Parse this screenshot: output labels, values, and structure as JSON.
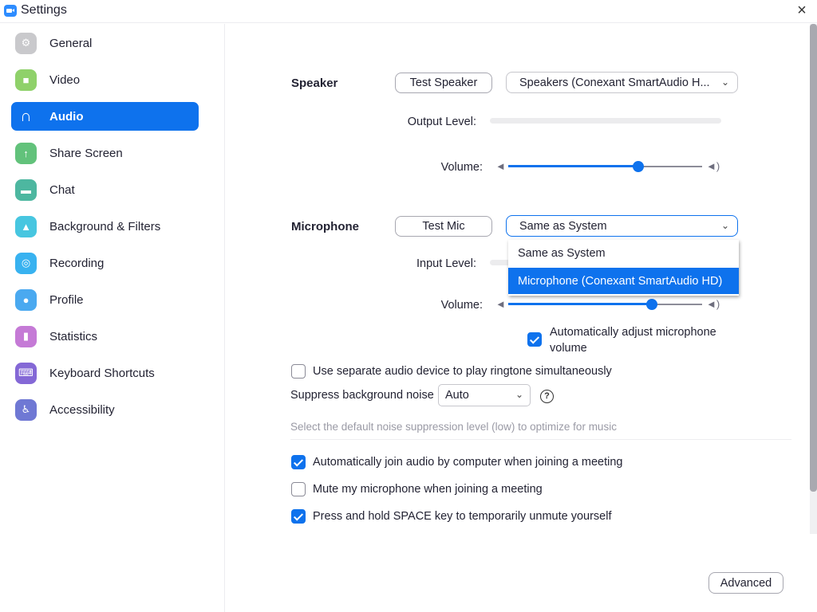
{
  "window": {
    "title": "Settings",
    "close_icon": "×"
  },
  "sidebar": {
    "items": [
      {
        "label": "General",
        "icon": "gear-icon",
        "color": "#c9c9cc",
        "glyph": "⚙",
        "active": false
      },
      {
        "label": "Video",
        "icon": "video-camera-icon",
        "color": "#8fd16a",
        "glyph": "■",
        "active": false
      },
      {
        "label": "Audio",
        "icon": "headphones-icon",
        "color": "#0e72ed",
        "glyph": "∩",
        "active": true
      },
      {
        "label": "Share Screen",
        "icon": "share-screen-icon",
        "color": "#62c27b",
        "glyph": "↑",
        "active": false
      },
      {
        "label": "Chat",
        "icon": "chat-icon",
        "color": "#4db7a0",
        "glyph": "▬",
        "active": false
      },
      {
        "label": "Background & Filters",
        "icon": "background-icon",
        "color": "#47c6e0",
        "glyph": "▲",
        "active": false
      },
      {
        "label": "Recording",
        "icon": "recording-icon",
        "color": "#38b2f0",
        "glyph": "◎",
        "active": false
      },
      {
        "label": "Profile",
        "icon": "profile-icon",
        "color": "#4aa9f0",
        "glyph": "●",
        "active": false
      },
      {
        "label": "Statistics",
        "icon": "statistics-icon",
        "color": "#c57ad6",
        "glyph": "▮",
        "active": false
      },
      {
        "label": "Keyboard Shortcuts",
        "icon": "keyboard-icon",
        "color": "#8468d6",
        "glyph": "⌨",
        "active": false
      },
      {
        "label": "Accessibility",
        "icon": "accessibility-icon",
        "color": "#6f78d4",
        "glyph": "♿",
        "active": false
      }
    ]
  },
  "speaker": {
    "label": "Speaker",
    "test_button": "Test Speaker",
    "device": "Speakers (Conexant SmartAudio H...",
    "output_level_label": "Output Level:",
    "output_level": 0,
    "volume_label": "Volume:",
    "volume": 0.67
  },
  "microphone": {
    "label": "Microphone",
    "test_button": "Test Mic",
    "device": "Same as System",
    "dropdown_options": [
      "Same as System",
      "Microphone (Conexant SmartAudio HD)"
    ],
    "dropdown_highlighted_index": 1,
    "input_level_label": "Input Level:",
    "input_level": 0,
    "volume_label": "Volume:",
    "volume": 0.74,
    "auto_adjust_label_line1": "Automatically adjust microphone",
    "auto_adjust_label_line2": "volume",
    "auto_adjust_checked": true
  },
  "options": {
    "separate_ringtone": {
      "label": "Use separate audio device to play ringtone simultaneously",
      "checked": false
    },
    "suppress_noise": {
      "label": "Suppress background noise",
      "value": "Auto",
      "help_icon": "?"
    },
    "hint": "Select the default noise suppression level (low) to optimize for music",
    "auto_join": {
      "label": "Automatically join audio by computer when joining a meeting",
      "checked": true
    },
    "mute_on_join": {
      "label": "Mute my microphone when joining a meeting",
      "checked": false
    },
    "space_unmute": {
      "label": "Press and hold SPACE key to temporarily unmute yourself",
      "checked": true
    }
  },
  "advanced_button": "Advanced",
  "accent_color": "#0e72ed"
}
